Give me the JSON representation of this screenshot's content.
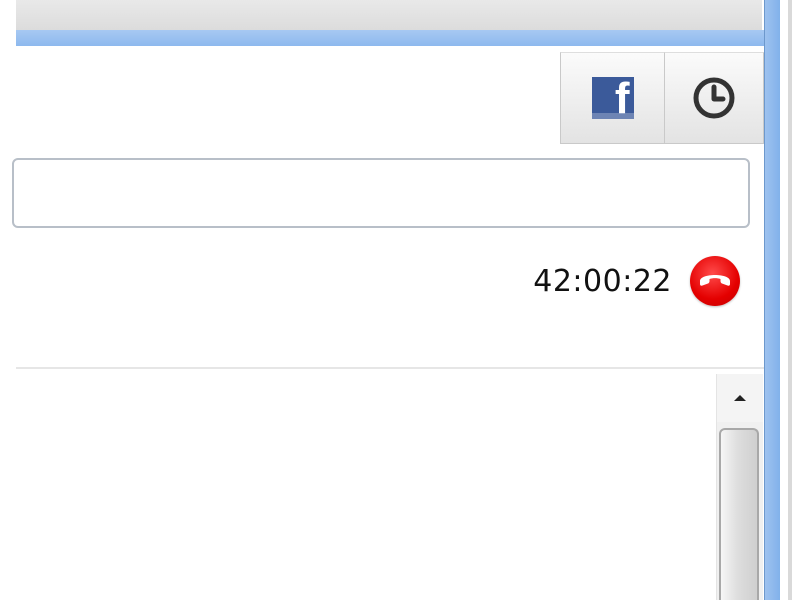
{
  "toolbar": {
    "facebook_glyph": "f",
    "facebook_icon": "facebook-icon",
    "history_icon": "clock-icon"
  },
  "message_input": {
    "value": "",
    "placeholder": ""
  },
  "call": {
    "timer": "42:00:22",
    "hangup_icon": "phone-hangup-icon"
  },
  "scrollbar": {
    "up_icon": "scroll-up-arrow-icon",
    "position": 0
  },
  "colors": {
    "facebook_blue": "#3b5a9a",
    "hangup_red": "#e40000",
    "frame_blue": "#8db9ee"
  }
}
